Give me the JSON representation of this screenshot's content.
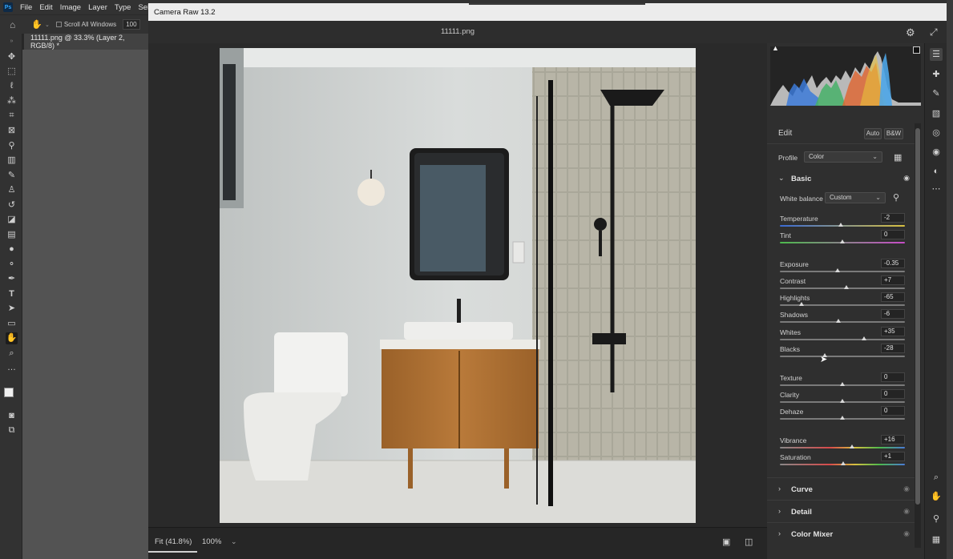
{
  "ps": {
    "menu": [
      "File",
      "Edit",
      "Image",
      "Layer",
      "Type",
      "Select"
    ],
    "options": {
      "scroll_all_windows": "Scroll All Windows",
      "zoom": "100"
    },
    "doc_tab": "11111.png @ 33.3% (Layer 2, RGB/8) *"
  },
  "cr": {
    "window_title": "Camera Raw 13.2",
    "filename": "11111.png",
    "footer": {
      "fit": "Fit (41.8%)",
      "zoom": "100%"
    },
    "panel": {
      "edit_label": "Edit",
      "auto_label": "Auto",
      "bw_label": "B&W",
      "profile_label": "Profile",
      "profile_value": "Color",
      "basic_title": "Basic",
      "wb_label": "White balance",
      "wb_value": "Custom",
      "sliders": [
        {
          "name": "Temperature",
          "value": "-2",
          "pos": 0.49
        },
        {
          "name": "Tint",
          "value": "0",
          "pos": 0.5
        },
        {
          "name": "Exposure",
          "value": "-0.35",
          "pos": 0.46
        },
        {
          "name": "Contrast",
          "value": "+7",
          "pos": 0.535
        },
        {
          "name": "Highlights",
          "value": "-65",
          "pos": 0.175
        },
        {
          "name": "Shadows",
          "value": "-6",
          "pos": 0.47
        },
        {
          "name": "Whites",
          "value": "+35",
          "pos": 0.675
        },
        {
          "name": "Blacks",
          "value": "-28",
          "pos": 0.36
        },
        {
          "name": "Texture",
          "value": "0",
          "pos": 0.5
        },
        {
          "name": "Clarity",
          "value": "0",
          "pos": 0.5
        },
        {
          "name": "Dehaze",
          "value": "0",
          "pos": 0.5
        },
        {
          "name": "Vibrance",
          "value": "+16",
          "pos": 0.58
        },
        {
          "name": "Saturation",
          "value": "+1",
          "pos": 0.505
        }
      ],
      "sections": [
        "Curve",
        "Detail",
        "Color Mixer"
      ]
    }
  }
}
